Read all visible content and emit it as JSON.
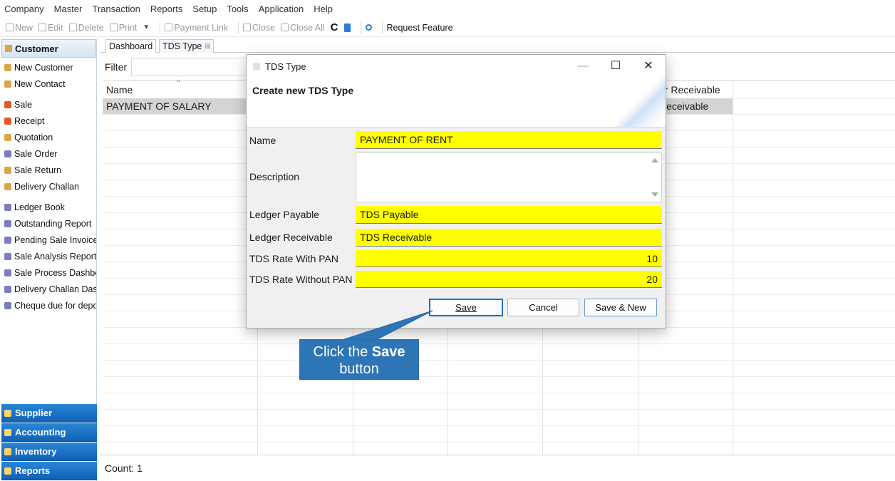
{
  "menu": [
    "Company",
    "Master",
    "Transaction",
    "Reports",
    "Setup",
    "Tools",
    "Application",
    "Help"
  ],
  "toolbar": {
    "new": "New",
    "edit": "Edit",
    "delete": "Delete",
    "print": "Print",
    "payment_link": "Payment Link",
    "close": "Close",
    "close_all": "Close All",
    "request_feature": "Request Feature"
  },
  "sidebar": {
    "header": "Customer",
    "items": [
      {
        "label": "New Customer",
        "icon": "user-icon"
      },
      {
        "label": "New Contact",
        "icon": "user-icon"
      },
      {
        "label": "Sale",
        "icon": "sale-icon"
      },
      {
        "label": "Receipt",
        "icon": "receipt-icon"
      },
      {
        "label": "Quotation",
        "icon": "user-icon"
      },
      {
        "label": "Sale Order",
        "icon": "order-icon"
      },
      {
        "label": "Sale Return",
        "icon": "user-icon"
      },
      {
        "label": "Delivery Challan",
        "icon": "user-icon"
      },
      {
        "label": "Ledger Book",
        "icon": "report-icon"
      },
      {
        "label": "Outstanding Report",
        "icon": "report-icon"
      },
      {
        "label": "Pending Sale Invoices",
        "icon": "report-icon"
      },
      {
        "label": "Sale Analysis Report",
        "icon": "report-icon"
      },
      {
        "label": "Sale Process Dashboa",
        "icon": "report-icon"
      },
      {
        "label": "Delivery Challan Dashl",
        "icon": "report-icon"
      },
      {
        "label": "Cheque due for depos",
        "icon": "report-icon"
      }
    ],
    "bottom": [
      "Supplier",
      "Accounting",
      "Inventory",
      "Reports"
    ]
  },
  "tabs": [
    {
      "label": "Dashboard"
    },
    {
      "label": "TDS Type",
      "close": "☒"
    }
  ],
  "grid": {
    "filter_label": "Filter",
    "columns": [
      "Name",
      "er Receivable"
    ],
    "rows": [
      [
        "PAYMENT OF SALARY",
        "Receivable"
      ]
    ],
    "count": "Count: 1"
  },
  "modal": {
    "title": "TDS Type",
    "subtitle": "Create new TDS Type",
    "fields": {
      "name_label": "Name",
      "name_value": "PAYMENT OF RENT",
      "description_label": "Description",
      "description_value": "",
      "ledger_payable_label": "Ledger Payable",
      "ledger_payable_value": "TDS Payable",
      "ledger_receivable_label": "Ledger Receivable",
      "ledger_receivable_value": "TDS Receivable",
      "rate_pan_label": "TDS Rate With PAN",
      "rate_pan_value": "10",
      "rate_nopan_label": "TDS Rate Without PAN",
      "rate_nopan_value": "20"
    },
    "buttons": {
      "save": "Save",
      "cancel": "Cancel",
      "save_new": "Save & New"
    }
  },
  "callout": {
    "text_pre": "Click the ",
    "text_bold": "Save",
    "text_post": "button"
  },
  "colors": {
    "field_highlight": "#ffff00",
    "callout": "#2e75b6",
    "sidebar_bottom": "#1a72c8"
  }
}
